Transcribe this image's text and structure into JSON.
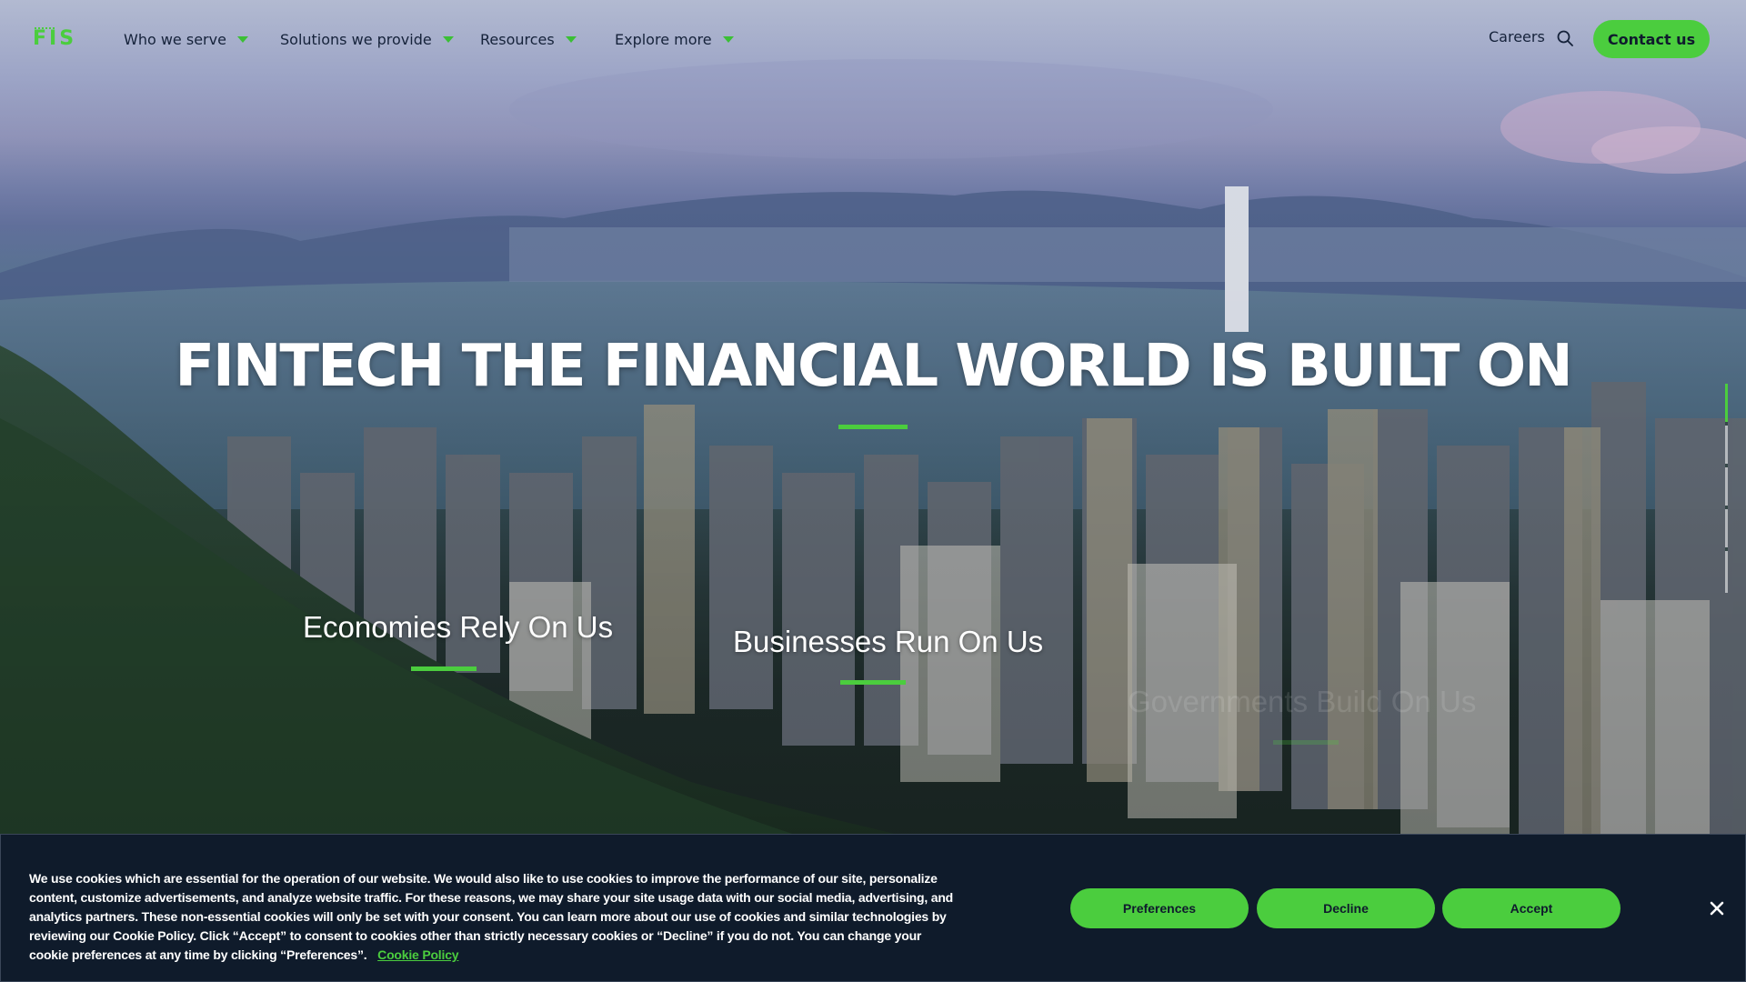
{
  "brand": {
    "logo_text": "FIS",
    "accent_color": "#4bcd3e",
    "nav_text_color": "#15223a",
    "banner_bg": "#0f1b2b"
  },
  "nav": {
    "items": [
      {
        "label": "Who we serve"
      },
      {
        "label": "Solutions we provide"
      },
      {
        "label": "Resources"
      },
      {
        "label": "Explore more"
      }
    ],
    "careers": "Careers",
    "search_icon": "search-icon",
    "contact_label": "Contact us"
  },
  "hero": {
    "headline": "FINTECH THE FINANCIAL WORLD IS BUILT ON",
    "taglines": [
      {
        "text": "Economies Rely On Us"
      },
      {
        "text": "Businesses Run On Us"
      },
      {
        "text": "Governments Build On Us"
      }
    ],
    "slide_rail_icon": "progress-rail"
  },
  "cookie": {
    "text": "We use cookies which are essential for the operation of our website. We would also like to use cookies to improve the performance of our site, personalize content, customize advertisements, and analyze website traffic. For these reasons, we may share your site usage data with our social media, advertising, and analytics partners. These non-essential cookies will only be set with your consent. You can learn more about our use of cookies and similar technologies by reviewing our Cookie Policy. Click “Accept” to consent to cookies other than strictly necessary cookies or “Decline” if you do not. You can change your cookie preferences at any time by clicking “Preferences”.",
    "link": "Cookie Policy",
    "buttons": {
      "preferences": "Preferences",
      "decline": "Decline",
      "accept": "Accept"
    },
    "close_icon": "close-icon"
  }
}
